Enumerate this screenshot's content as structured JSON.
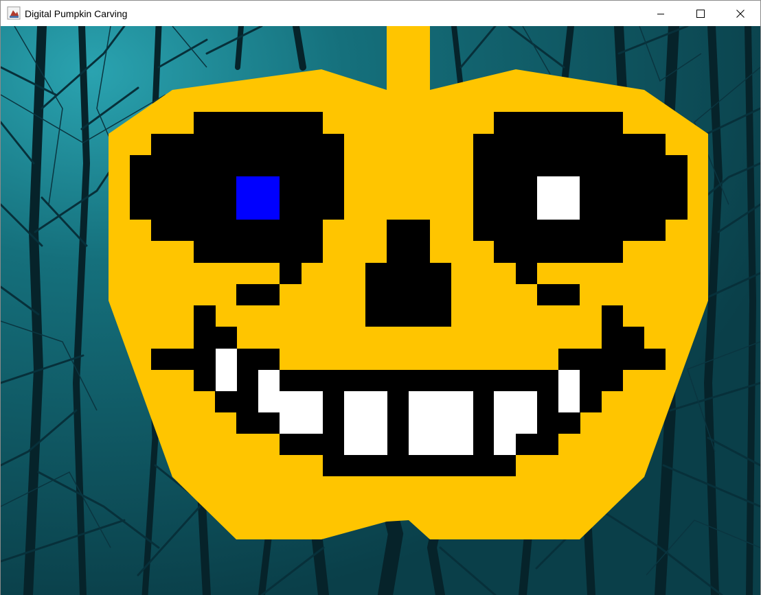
{
  "window": {
    "title": "Digital Pumpkin Carving",
    "app_icon": "java-cup-icon",
    "controls": {
      "minimize": "minimize-icon",
      "maximize": "maximize-icon",
      "close": "close-icon"
    }
  },
  "scene": {
    "background": "dark-teal-forest",
    "colors": {
      "sky": "#0f5561",
      "sky_light": "#1f8b98",
      "trees": "#06232a",
      "pumpkin": "#ffc500",
      "carve": "#000000",
      "left_pupil": "#0000ff",
      "right_pupil": "#ffffff",
      "teeth": "#ffffff"
    }
  }
}
